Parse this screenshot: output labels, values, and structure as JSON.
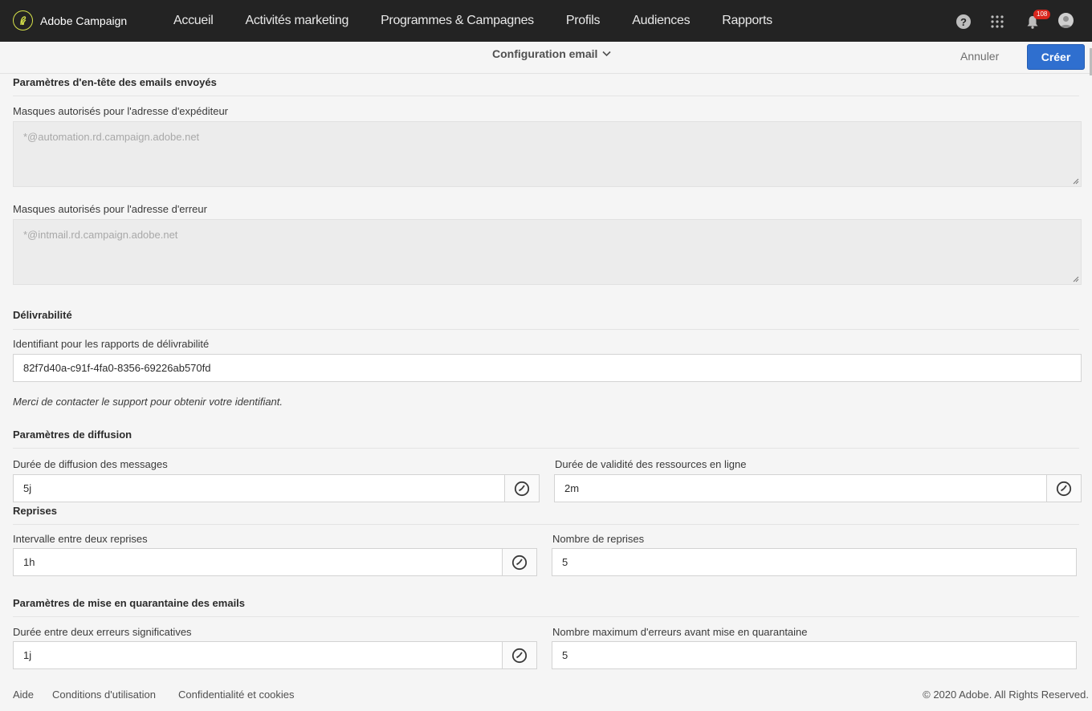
{
  "app": {
    "brand": "Adobe Campaign"
  },
  "nav": {
    "items": [
      "Accueil",
      "Activités marketing",
      "Programmes & Campagnes",
      "Profils",
      "Audiences",
      "Rapports"
    ]
  },
  "topbar": {
    "help_glyph": "?",
    "notification_count": "108"
  },
  "header": {
    "title": "Configuration email",
    "cancel_label": "Annuler",
    "create_label": "Créer"
  },
  "sections": {
    "headers": {
      "title": "Paramètres d'en-tête des emails envoyés",
      "sender_label": "Masques autorisés pour l'adresse d'expéditeur",
      "sender_placeholder": "*@automation.rd.campaign.adobe.net",
      "error_label": "Masques autorisés pour l'adresse d'erreur",
      "error_placeholder": "*@intmail.rd.campaign.adobe.net"
    },
    "deliverability": {
      "title": "Délivrabilité",
      "id_label": "Identifiant pour les rapports de délivrabilité",
      "id_value": "82f7d40a-c91f-4fa0-8356-69226ab570fd",
      "hint": "Merci de contacter le support pour obtenir votre identifiant."
    },
    "diffusion": {
      "title": "Paramètres de diffusion",
      "duration_label": "Durée de diffusion des messages",
      "duration_value": "5j",
      "validity_label": "Durée de validité des ressources en ligne",
      "validity_value": "2m"
    },
    "retries": {
      "title": "Reprises",
      "interval_label": "Intervalle entre deux reprises",
      "interval_value": "1h",
      "count_label": "Nombre de reprises",
      "count_value": "5"
    },
    "quarantine": {
      "title": "Paramètres de mise en quarantaine des emails",
      "duration_label": "Durée entre deux erreurs significatives",
      "duration_value": "1j",
      "max_label": "Nombre maximum d'erreurs avant mise en quarantaine",
      "max_value": "5"
    }
  },
  "footer": {
    "help": "Aide",
    "terms": "Conditions d'utilisation",
    "privacy": "Confidentialité et cookies",
    "copyright": "© 2020 Adobe. All Rights Reserved."
  },
  "colors": {
    "topbar": "#232323",
    "primary": "#2f6fcf",
    "logo_accent": "#d7e34a",
    "badge": "#d9251c"
  }
}
